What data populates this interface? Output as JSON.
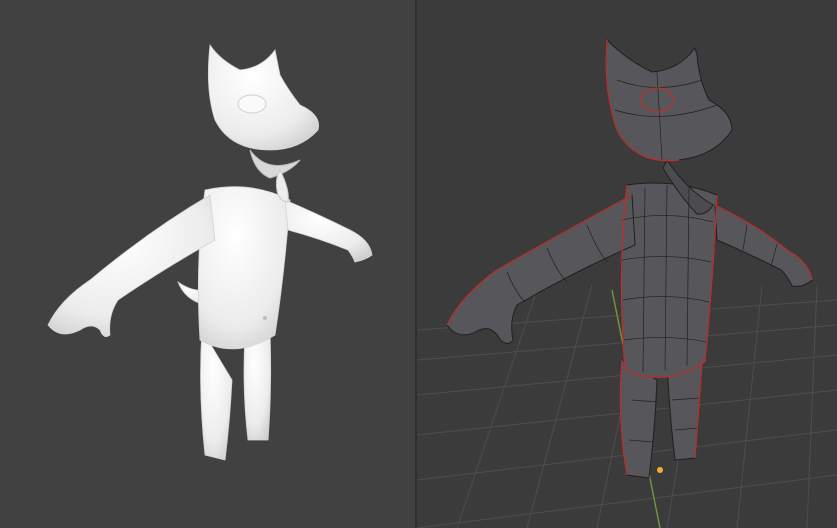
{
  "figure": {
    "panels": [
      {
        "id": "left",
        "shading": "solid-white",
        "subject": "wolf-character"
      },
      {
        "id": "right",
        "shading": "wireframe",
        "subject": "wolf-character",
        "grid": true
      }
    ]
  },
  "colors": {
    "left_bg": "#414141",
    "right_bg": "#3b3b3b",
    "clay": "#f2f2f2",
    "wire_mesh": "#5a5a5f",
    "wire_edge": "#1c1c1c",
    "seam": "#c0302a",
    "grid": "#505050",
    "axis_green": "#6e9a3a",
    "origin": "#f0b030"
  }
}
